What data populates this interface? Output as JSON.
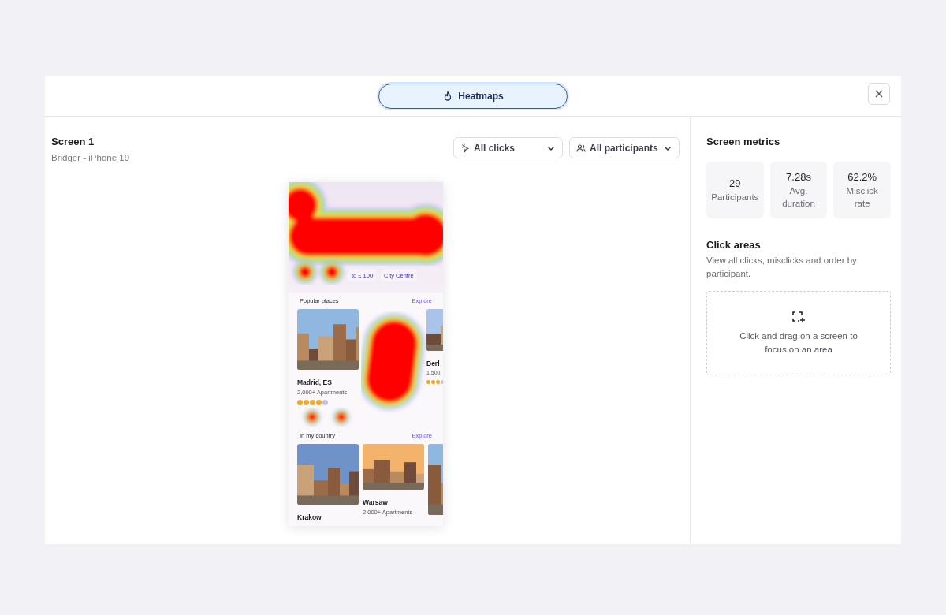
{
  "header": {
    "tab": {
      "label": "Heatmaps",
      "selected": true
    }
  },
  "screen": {
    "title": "Screen 1",
    "subtitle": "Bridger - iPhone 19"
  },
  "filters": [
    {
      "label": "All clicks",
      "kind": "clicks"
    },
    {
      "label": "All participants",
      "kind": "participants"
    }
  ],
  "prototype": {
    "chips": [
      "to £ 100",
      "City Centre"
    ],
    "sections": [
      {
        "title": "Popular places",
        "link": "Explore",
        "cards": [
          {
            "title": "Madrid, ES",
            "subtitle": "2,000+ Apartments",
            "stars": 4
          },
          {
            "title": "Berl",
            "subtitle": "1,500",
            "stars": 3
          }
        ]
      },
      {
        "title": "In my country",
        "link": "Explore",
        "cards": [
          {
            "title": "Krakow"
          },
          {
            "title": "Warsaw",
            "subtitle": "2,000+ Apartments"
          },
          {
            "kind": "picture"
          }
        ]
      }
    ]
  },
  "metrics": {
    "title": "Screen metrics",
    "items": [
      {
        "value": "29",
        "label": "Participants"
      },
      {
        "value": "7.28s",
        "label": "Avg. duration"
      },
      {
        "value": "62.2%",
        "label": "Misclick rate"
      }
    ]
  },
  "click_areas": {
    "title": "Click areas",
    "description": "View all clicks, misclicks and order by participant.",
    "dropzone": "Click and drag on a screen to focus on an area"
  }
}
